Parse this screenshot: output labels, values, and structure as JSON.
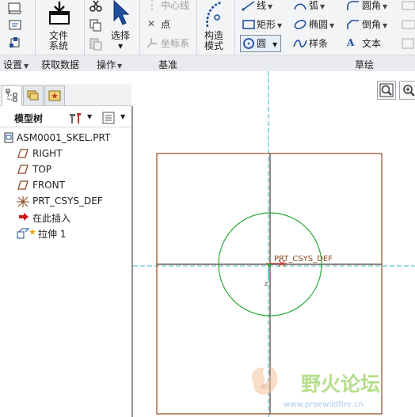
{
  "ribbon": {
    "groups": {
      "settings": "设置",
      "get_data": "获取数据",
      "operations": "操作",
      "datum": "基准",
      "sketch": "草绘"
    },
    "buttons": {
      "file_system_line1": "文件",
      "file_system_line2": "系统",
      "select": "选择",
      "centerline": "中心线",
      "point": "点",
      "coord_sys": "坐标系",
      "construction_line1": "构造",
      "construction_line2": "模式",
      "line": "线",
      "arc": "弧",
      "fillet": "圆角",
      "rectangle": "矩形",
      "ellipse": "椭圆",
      "chamfer": "倒角",
      "circle": "圆",
      "spline": "样条",
      "text": "文本"
    }
  },
  "model_tree": {
    "header": "模型树",
    "items": [
      {
        "label": "ASM0001_SKEL.PRT",
        "icon": "part-icon"
      },
      {
        "label": "RIGHT",
        "icon": "datum-plane-icon"
      },
      {
        "label": "TOP",
        "icon": "datum-plane-icon"
      },
      {
        "label": "FRONT",
        "icon": "datum-plane-icon"
      },
      {
        "label": "PRT_CSYS_DEF",
        "icon": "csys-icon"
      },
      {
        "label": "在此插入",
        "icon": "insert-arrow-icon"
      },
      {
        "label": "拉伸 1",
        "icon": "extrude-icon"
      }
    ]
  },
  "graphics": {
    "csys_label": "PRT_CSYS_DEF",
    "watermark_cn": "野火论坛",
    "watermark_url": "www.proewildfire.cn"
  },
  "colors": {
    "sketch_frame": "#8b4a1e",
    "circle": "#2aa83a",
    "datum_axis": "#31b5c8",
    "accent_blue": "#1f4fa0",
    "watermark_green": "#9fd36a"
  }
}
